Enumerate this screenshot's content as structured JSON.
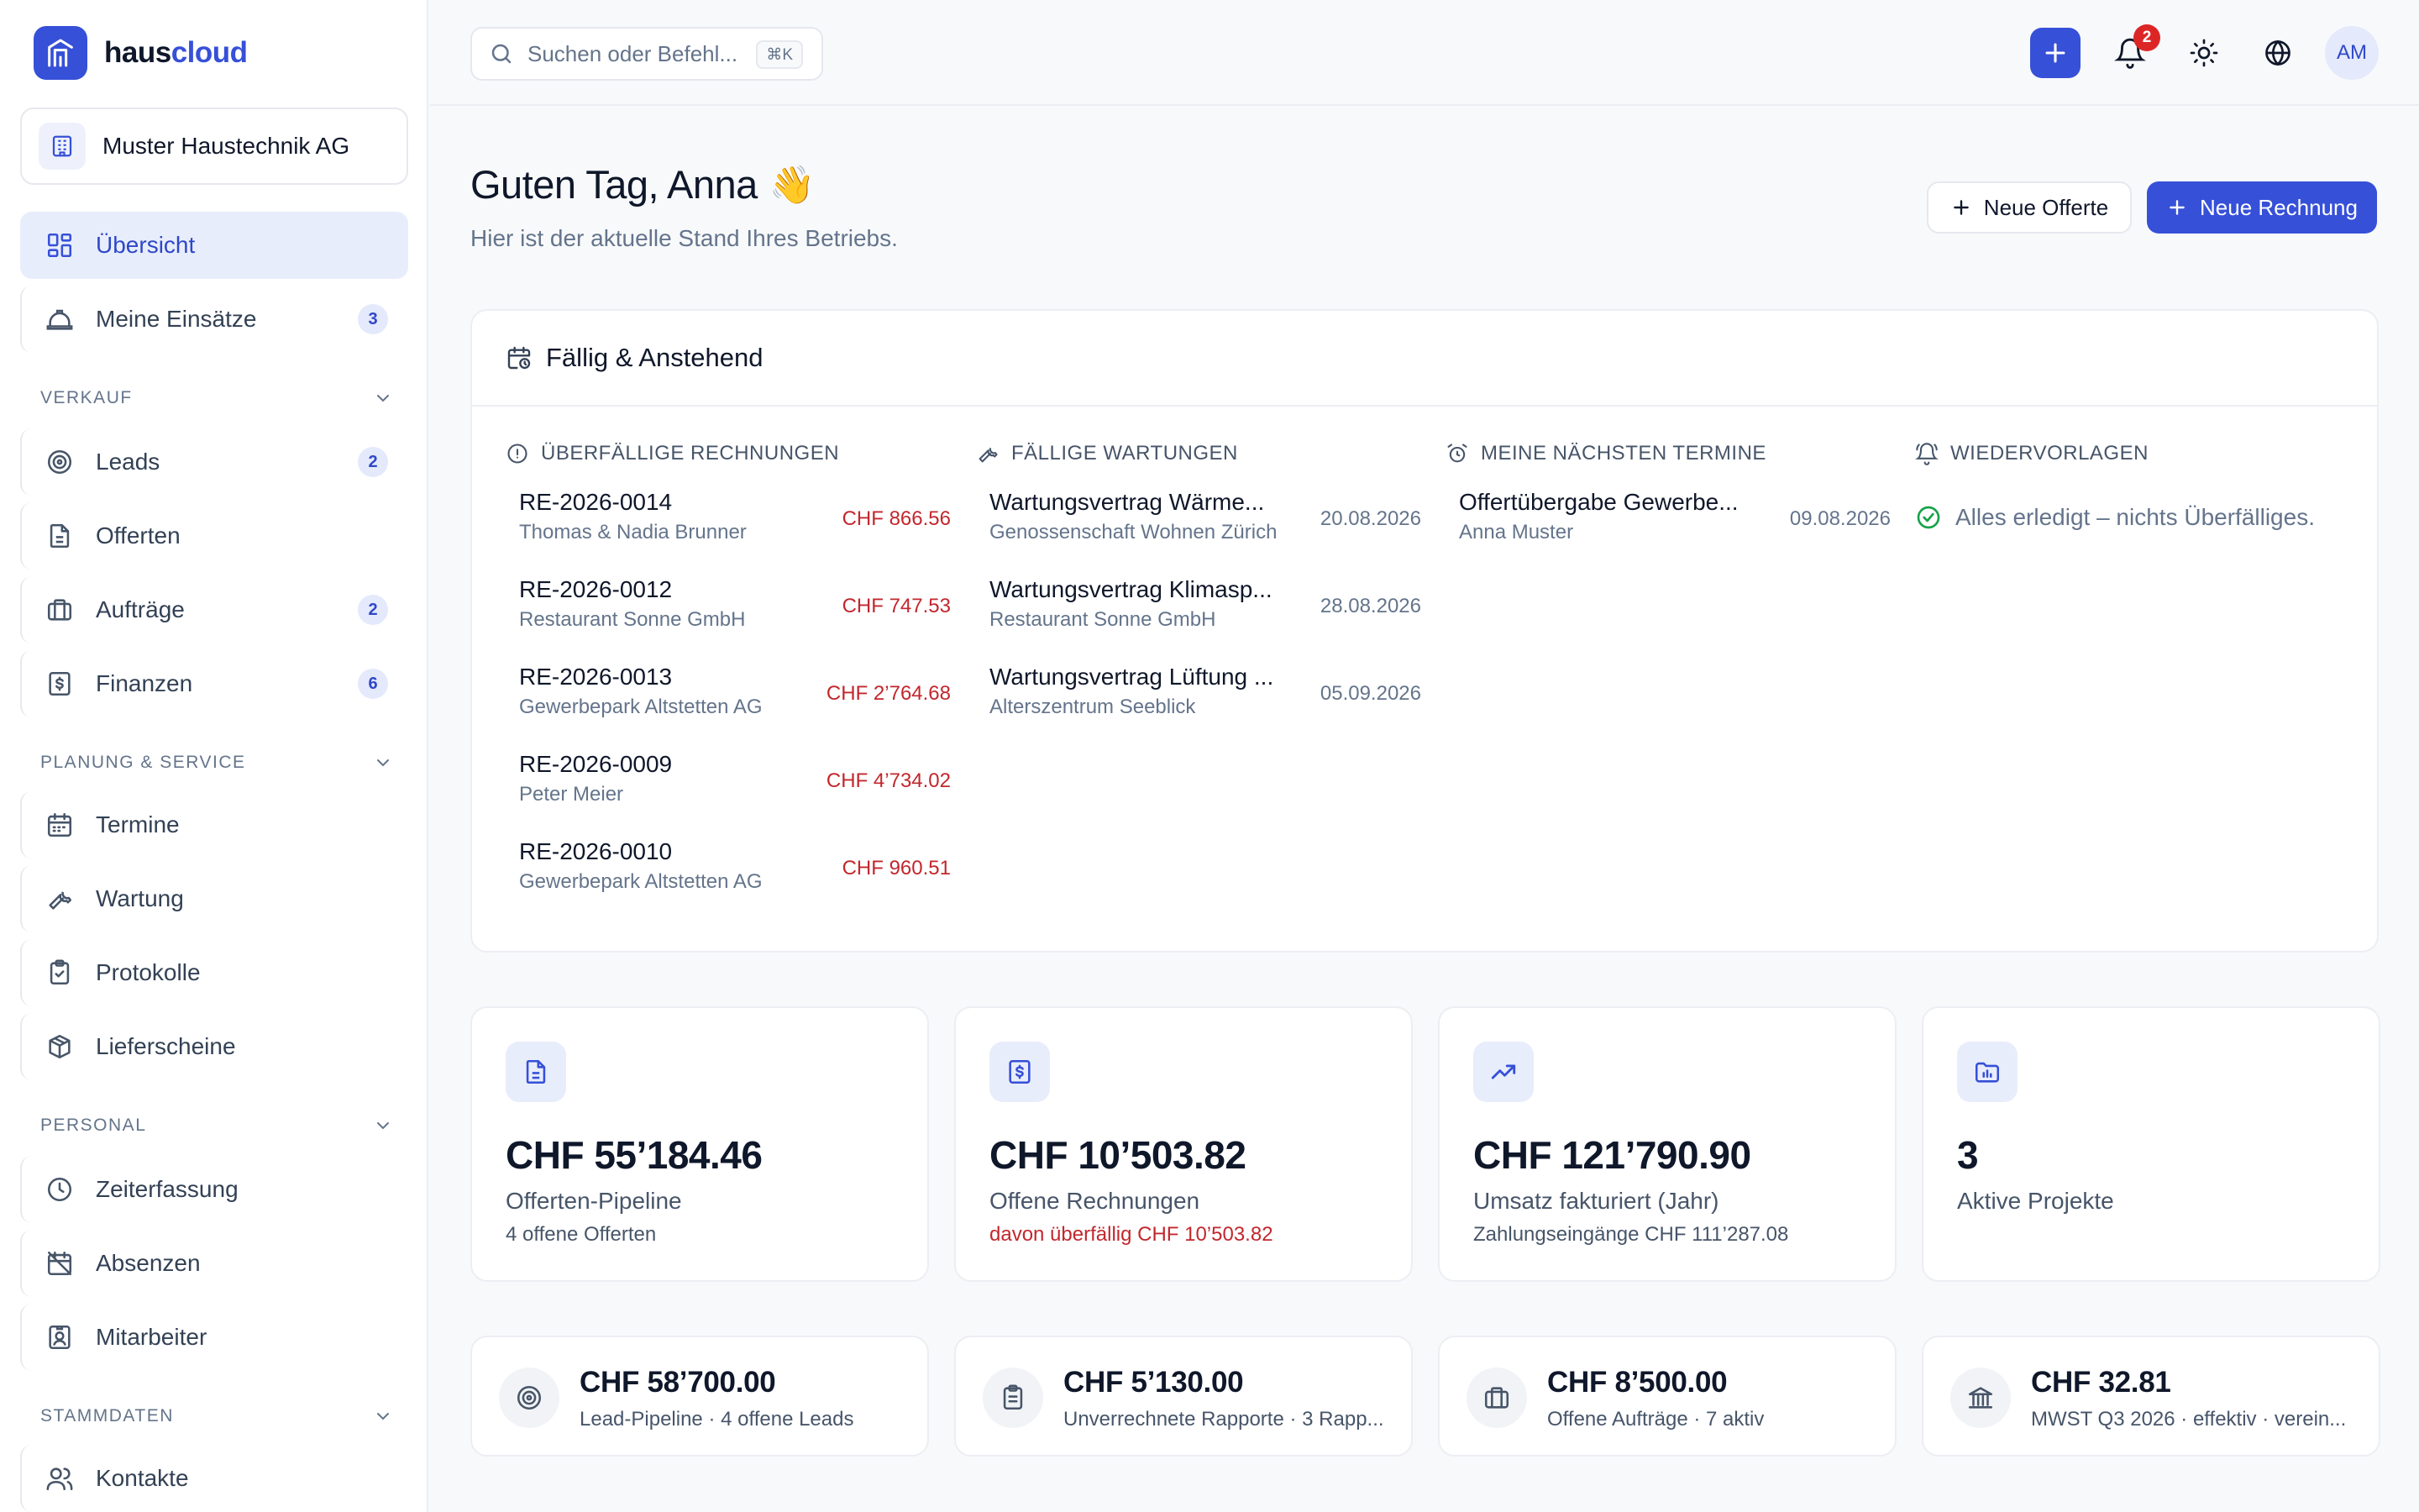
{
  "brand": {
    "name_part1": "haus",
    "name_part2": "cloud",
    "accent": "#3650d8"
  },
  "sidebar": {
    "company": "Muster Haustechnik AG",
    "items_top": [
      {
        "label": "Übersicht",
        "icon": "dashboard-icon",
        "active": true
      },
      {
        "label": "Meine Einsätze",
        "icon": "hardhat-icon",
        "badge": "3"
      }
    ],
    "sections": [
      {
        "title": "VERKAUF",
        "items": [
          {
            "label": "Leads",
            "icon": "target-icon",
            "badge": "2"
          },
          {
            "label": "Offerten",
            "icon": "document-icon"
          },
          {
            "label": "Aufträge",
            "icon": "briefcase-icon",
            "badge": "2"
          },
          {
            "label": "Finanzen",
            "icon": "invoice-icon",
            "badge": "6"
          }
        ]
      },
      {
        "title": "PLANUNG & SERVICE",
        "items": [
          {
            "label": "Termine",
            "icon": "calendar-icon"
          },
          {
            "label": "Wartung",
            "icon": "wrench-icon"
          },
          {
            "label": "Protokolle",
            "icon": "clipboard-check-icon"
          },
          {
            "label": "Lieferscheine",
            "icon": "package-icon"
          }
        ]
      },
      {
        "title": "PERSONAL",
        "items": [
          {
            "label": "Zeiterfassung",
            "icon": "clock-icon"
          },
          {
            "label": "Absenzen",
            "icon": "calendar-off-icon"
          },
          {
            "label": "Mitarbeiter",
            "icon": "id-badge-icon"
          }
        ]
      },
      {
        "title": "STAMMDATEN",
        "items": [
          {
            "label": "Kontakte",
            "icon": "users-icon"
          }
        ]
      }
    ]
  },
  "topbar": {
    "search_placeholder": "Suchen oder Befehl...",
    "shortcut": "⌘K",
    "notification_count": "2",
    "avatar_initials": "AM"
  },
  "header": {
    "greeting": "Guten Tag, Anna",
    "wave": "👋",
    "subtitle": "Hier ist der aktuelle Stand Ihres Betriebs.",
    "btn_offer": "Neue Offerte",
    "btn_invoice": "Neue Rechnung"
  },
  "due": {
    "title": "Fällig & Anstehend",
    "overdue": {
      "title": "ÜBERFÄLLIGE RECHNUNGEN",
      "rows": [
        {
          "id": "RE-2026-0014",
          "client": "Thomas & Nadia Brunner",
          "amount": "CHF 866.56"
        },
        {
          "id": "RE-2026-0012",
          "client": "Restaurant Sonne GmbH",
          "amount": "CHF 747.53"
        },
        {
          "id": "RE-2026-0013",
          "client": "Gewerbepark Altstetten AG",
          "amount": "CHF 2’764.68"
        },
        {
          "id": "RE-2026-0009",
          "client": "Peter Meier",
          "amount": "CHF 4’734.02"
        },
        {
          "id": "RE-2026-0010",
          "client": "Gewerbepark Altstetten AG",
          "amount": "CHF 960.51"
        }
      ]
    },
    "maintenance": {
      "title": "FÄLLIGE WARTUNGEN",
      "rows": [
        {
          "name": "Wartungsvertrag Wärme...",
          "client": "Genossenschaft Wohnen Zürich",
          "date": "20.08.2026"
        },
        {
          "name": "Wartungsvertrag Klimasp...",
          "client": "Restaurant Sonne GmbH",
          "date": "28.08.2026"
        },
        {
          "name": "Wartungsvertrag Lüftung ...",
          "client": "Alterszentrum Seeblick",
          "date": "05.09.2026"
        }
      ]
    },
    "appointments": {
      "title": "MEINE NÄCHSTEN TERMINE",
      "rows": [
        {
          "name": "Offertübergabe Gewerbe...",
          "person": "Anna Muster",
          "date": "09.08.2026"
        }
      ]
    },
    "followups": {
      "title": "WIEDERVORLAGEN",
      "empty": "Alles erledigt – nichts Überfälliges."
    }
  },
  "stats": [
    {
      "icon": "document-icon",
      "value": "CHF 55’184.46",
      "label": "Offerten-Pipeline",
      "note": "4 offene Offerten",
      "note_red": false
    },
    {
      "icon": "invoice-icon",
      "value": "CHF 10’503.82",
      "label": "Offene Rechnungen",
      "note": "davon überfällig CHF 10’503.82",
      "note_red": true
    },
    {
      "icon": "trending-up-icon",
      "value": "CHF 121’790.90",
      "label": "Umsatz fakturiert (Jahr)",
      "note": "Zahlungseingänge CHF 111’287.08",
      "note_red": false
    },
    {
      "icon": "folder-chart-icon",
      "value": "3",
      "label": "Aktive Projekte",
      "note": "",
      "note_red": false
    }
  ],
  "mini_stats": [
    {
      "icon": "target-icon",
      "value": "CHF 58’700.00",
      "sub": "Lead-Pipeline · 4 offene Leads"
    },
    {
      "icon": "clipboard-icon",
      "value": "CHF 5’130.00",
      "sub": "Unverrechnete Rapporte · 3 Rapp..."
    },
    {
      "icon": "briefcase-icon",
      "value": "CHF 8’500.00",
      "sub": "Offene Aufträge · 7 aktiv"
    },
    {
      "icon": "bank-icon",
      "value": "CHF 32.81",
      "sub": "MWST Q3 2026 · effektiv · verein..."
    }
  ]
}
